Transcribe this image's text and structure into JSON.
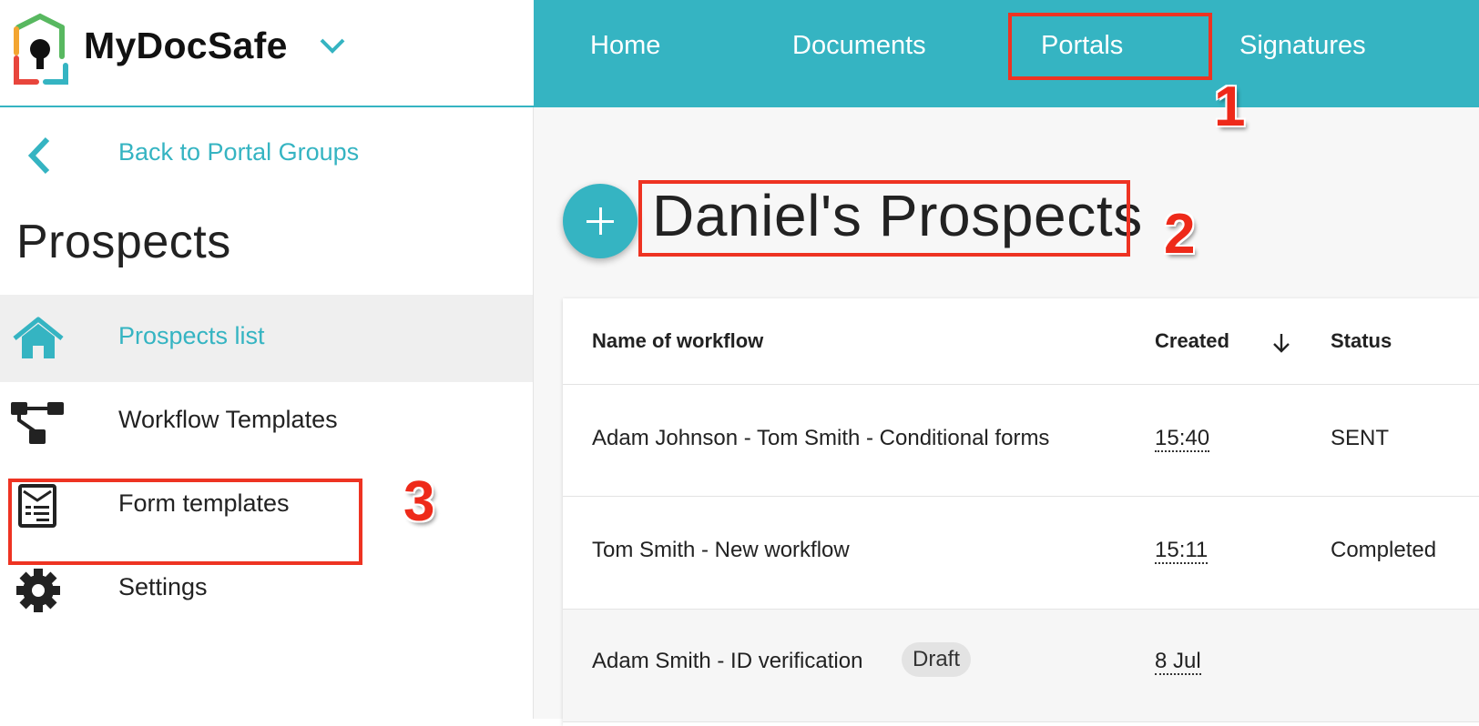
{
  "app": {
    "name": "MyDocSafe",
    "colors": {
      "accent": "#35b4c2",
      "annotation": "#ee3322"
    }
  },
  "topnav": {
    "items": [
      {
        "label": "Home"
      },
      {
        "label": "Documents"
      },
      {
        "label": "Portals"
      },
      {
        "label": "Signatures"
      }
    ]
  },
  "sidebar": {
    "back_label": "Back to Portal Groups",
    "title": "Prospects",
    "items": [
      {
        "label": "Prospects list",
        "icon": "home-icon",
        "active": true
      },
      {
        "label": "Workflow Templates",
        "icon": "workflow-icon",
        "active": false
      },
      {
        "label": "Form templates",
        "icon": "form-icon",
        "active": false
      },
      {
        "label": "Settings",
        "icon": "gear-icon",
        "active": false
      }
    ]
  },
  "main": {
    "title": "Daniel's Prospects",
    "table": {
      "columns": [
        "Name of workflow",
        "Created",
        "Status"
      ],
      "rows": [
        {
          "name": "Adam Johnson - Tom Smith - Conditional forms",
          "created": "15:40",
          "status": "SENT",
          "badge": ""
        },
        {
          "name": "Tom Smith - New workflow",
          "created": "15:11",
          "status": "Completed",
          "badge": ""
        },
        {
          "name": "Adam Smith - ID verification",
          "created": "8 Jul",
          "status": "",
          "badge": "Draft"
        }
      ]
    }
  },
  "annotations": [
    "1",
    "2",
    "3"
  ]
}
